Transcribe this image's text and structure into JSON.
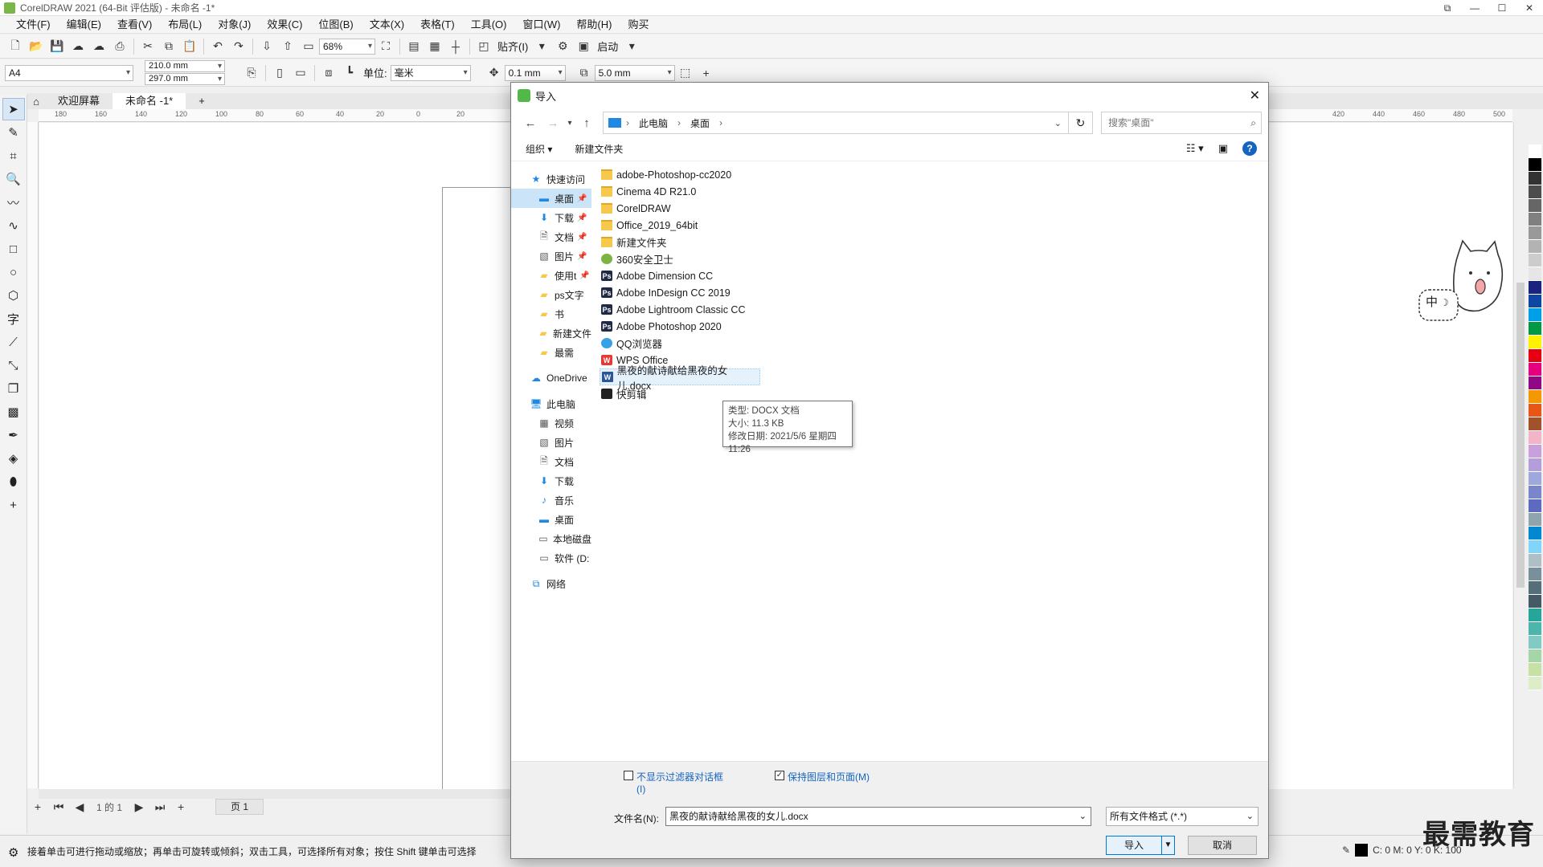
{
  "window": {
    "title": "CorelDRAW 2021 (64-Bit 评估版) - 未命名 -1*"
  },
  "menu": [
    "文件(F)",
    "编辑(E)",
    "查看(V)",
    "布局(L)",
    "对象(J)",
    "效果(C)",
    "位图(B)",
    "文本(X)",
    "表格(T)",
    "工具(O)",
    "窗口(W)",
    "帮助(H)",
    "购买"
  ],
  "toolbar1": {
    "zoom": "68%",
    "snap_label": "贴齐(I)",
    "launch_label": "启动"
  },
  "toolbar2": {
    "page_size": "A4",
    "width": "210.0 mm",
    "height": "297.0 mm",
    "units_label": "单位:",
    "units_value": "毫米",
    "nudge": "0.1 mm",
    "dup_x": "5.0 mm"
  },
  "tabs": {
    "welcome": "欢迎屏幕",
    "document": "未命名 -1*",
    "add": "+"
  },
  "ruler_ticks": [
    "180",
    "160",
    "140",
    "120",
    "100",
    "80",
    "60",
    "40",
    "20",
    "0",
    "20",
    "420",
    "440",
    "460",
    "480",
    "500"
  ],
  "pagebar": {
    "of_text": "1 的 1",
    "page_tab": "页 1"
  },
  "status": {
    "hint": "接着单击可进行拖动或缩放；再单击可旋转或倾斜；双击工具，可选择所有对象；按住 Shift 键单击可选择",
    "color_readout": "C: 0 M: 0 Y: 0 K: 100"
  },
  "watermark": "最需教育",
  "sticker_text": "中",
  "palette_colors": [
    "#ffffff",
    "#000000",
    "#333333",
    "#4d4d4d",
    "#666666",
    "#808080",
    "#999999",
    "#b3b3b3",
    "#cccccc",
    "#e6e6e6",
    "#1a237e",
    "#0d47a1",
    "#00a0e9",
    "#009944",
    "#fff100",
    "#e60012",
    "#e4007f",
    "#920783",
    "#f39800",
    "#e95513",
    "#a0522d",
    "#f4b4c7",
    "#c9a0dc",
    "#b39ddb",
    "#9fa8da",
    "#7986cb",
    "#5c6bc0",
    "#90a4ae",
    "#0288d1",
    "#81d4fa",
    "#b0bec5",
    "#78909c",
    "#546e7a",
    "#455a64",
    "#26a69a",
    "#4db6ac",
    "#80cbc4",
    "#a5d6a7",
    "#c5e1a5",
    "#dcedc8"
  ],
  "dialog": {
    "title": "导入",
    "address": {
      "pc": "此电脑",
      "desktop": "桌面"
    },
    "search_placeholder": "搜索\"桌面\"",
    "organize": "组织 ▾",
    "new_folder": "新建文件夹",
    "help": "?",
    "nav": {
      "quick_access": "快速访问",
      "quick_items": [
        {
          "label": "桌面",
          "icon": "desktop-icon",
          "pinned": true,
          "selected": true
        },
        {
          "label": "下载",
          "icon": "download-icon",
          "pinned": true
        },
        {
          "label": "文档",
          "icon": "document-icon",
          "pinned": true
        },
        {
          "label": "图片",
          "icon": "picture-icon",
          "pinned": true
        },
        {
          "label": "使用t",
          "icon": "folder-icon",
          "pinned": true
        },
        {
          "label": "ps文字",
          "icon": "folder-icon"
        },
        {
          "label": "书",
          "icon": "folder-icon"
        },
        {
          "label": "新建文件",
          "icon": "folder-icon"
        },
        {
          "label": "最需",
          "icon": "folder-icon"
        }
      ],
      "onedrive": "OneDrive",
      "this_pc": "此电脑",
      "pc_items": [
        {
          "label": "视频",
          "icon": "video-icon"
        },
        {
          "label": "图片",
          "icon": "picture-icon"
        },
        {
          "label": "文档",
          "icon": "document-icon"
        },
        {
          "label": "下载",
          "icon": "download-icon"
        },
        {
          "label": "音乐",
          "icon": "music-icon"
        },
        {
          "label": "桌面",
          "icon": "desktop-icon"
        },
        {
          "label": "本地磁盘",
          "icon": "disk-icon"
        },
        {
          "label": "软件 (D:",
          "icon": "disk-icon"
        }
      ],
      "network": "网络"
    },
    "files": [
      {
        "name": "adobe-Photoshop-cc2020",
        "icon": "folder"
      },
      {
        "name": "Cinema 4D R21.0",
        "icon": "folder"
      },
      {
        "name": "CorelDRAW",
        "icon": "folder"
      },
      {
        "name": "Office_2019_64bit",
        "icon": "folder"
      },
      {
        "name": "新建文件夹",
        "icon": "folder"
      },
      {
        "name": "360安全卫士",
        "icon": "safe"
      },
      {
        "name": "Adobe Dimension CC",
        "icon": "app"
      },
      {
        "name": "Adobe InDesign CC 2019",
        "icon": "app"
      },
      {
        "name": "Adobe Lightroom Classic CC",
        "icon": "app"
      },
      {
        "name": "Adobe Photoshop 2020",
        "icon": "app"
      },
      {
        "name": "QQ浏览器",
        "icon": "qq"
      },
      {
        "name": "WPS Office",
        "icon": "wps"
      },
      {
        "name": "黑夜的献诗献给黑夜的女儿.docx",
        "icon": "doc",
        "highlighted": true
      },
      {
        "name": "快剪辑",
        "icon": "clip"
      }
    ],
    "tooltip": {
      "type": "类型: DOCX 文档",
      "size": "大小: 11.3 KB",
      "modified": "修改日期: 2021/5/6 星期四 11:26"
    },
    "checkbox_filter": {
      "label": "不显示过滤器对话框",
      "label2": "(I)",
      "checked": false
    },
    "checkbox_layers": {
      "label": "保持图层和页面(M)",
      "checked": true
    },
    "filename_label": "文件名(N):",
    "filename_value": "黑夜的献诗献给黑夜的女儿.docx",
    "filetype_value": "所有文件格式 (*.*)",
    "import_label": "导入",
    "cancel_label": "取消"
  }
}
